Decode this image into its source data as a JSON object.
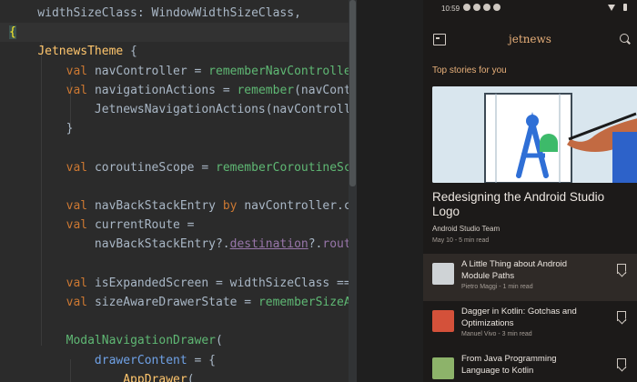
{
  "editor": {
    "lines": [
      [
        [
          "    widthSizeClass: WindowWidthSizeClass,",
          "plain"
        ]
      ],
      [
        [
          "{",
          "plain"
        ]
      ],
      [
        [
          "    ",
          "plain"
        ],
        [
          "JetnewsTheme",
          "fn"
        ],
        [
          " {",
          "plain"
        ]
      ],
      [
        [
          "        ",
          "plain"
        ],
        [
          "val ",
          "kw"
        ],
        [
          "navController = ",
          "plain"
        ],
        [
          "rememberNavController",
          "comp"
        ],
        [
          "()",
          "plain"
        ]
      ],
      [
        [
          "        ",
          "plain"
        ],
        [
          "val ",
          "kw"
        ],
        [
          "navigationActions = ",
          "plain"
        ],
        [
          "remember",
          "comp"
        ],
        [
          "(navContr",
          "plain"
        ]
      ],
      [
        [
          "            JetnewsNavigationActions(navControlle",
          "plain"
        ]
      ],
      [
        [
          "        }",
          "plain"
        ]
      ],
      [
        [
          "",
          "plain"
        ]
      ],
      [
        [
          "        ",
          "plain"
        ],
        [
          "val ",
          "kw"
        ],
        [
          "coroutineScope = ",
          "plain"
        ],
        [
          "rememberCoroutineSco",
          "comp"
        ]
      ],
      [
        [
          "",
          "plain"
        ]
      ],
      [
        [
          "        ",
          "plain"
        ],
        [
          "val ",
          "kw"
        ],
        [
          "navBackStackEntry ",
          "plain"
        ],
        [
          "by ",
          "kw"
        ],
        [
          "navController.",
          "plain"
        ],
        [
          "cu",
          "call"
        ]
      ],
      [
        [
          "        ",
          "plain"
        ],
        [
          "val ",
          "kw"
        ],
        [
          "currentRoute =",
          "plain"
        ]
      ],
      [
        [
          "            navBackStackEntry?.",
          "plain"
        ],
        [
          "destination",
          "prop-und"
        ],
        [
          "?.",
          "plain"
        ],
        [
          "route",
          "prop"
        ]
      ],
      [
        [
          "",
          "plain"
        ]
      ],
      [
        [
          "        ",
          "plain"
        ],
        [
          "val ",
          "kw"
        ],
        [
          "isExpandedScreen = widthSizeClass ==",
          "plain"
        ]
      ],
      [
        [
          "        ",
          "plain"
        ],
        [
          "val ",
          "kw"
        ],
        [
          "sizeAwareDrawerState = ",
          "plain"
        ],
        [
          "rememberSizeAw",
          "comp"
        ]
      ],
      [
        [
          "",
          "plain"
        ]
      ],
      [
        [
          "        ",
          "plain"
        ],
        [
          "ModalNavigationDrawer",
          "comp"
        ],
        [
          "(",
          "plain"
        ]
      ],
      [
        [
          "            ",
          "plain"
        ],
        [
          "drawerContent",
          "prop-blue"
        ],
        [
          " = {",
          "plain"
        ]
      ],
      [
        [
          "                ",
          "plain"
        ],
        [
          "AppDrawer",
          "fn"
        ],
        [
          "(",
          "plain"
        ]
      ]
    ]
  },
  "phone": {
    "status_time": "10:59",
    "app_title": "jetnews",
    "section_title": "Top stories for you",
    "hero": {
      "title": "Redesigning the Android Studio Logo",
      "author": "Android Studio Team",
      "meta": "May 10 - 5 min read"
    },
    "posts": [
      {
        "title": "A Little Thing about Android Module Paths",
        "meta": "Pietro Maggi - 1 min read",
        "thumb_color": "#cfd3d6",
        "selected": true
      },
      {
        "title": "Dagger in Kotlin: Gotchas and Optimizations",
        "meta": "Manuel Vivo - 3 min read",
        "thumb_color": "#d4513a",
        "selected": false
      },
      {
        "title": "From Java Programming Language to Kotlin",
        "meta": "",
        "thumb_color": "#8db36a",
        "selected": false
      }
    ],
    "colors": {
      "accent": "#e8b07a",
      "background": "#1c1a19"
    }
  }
}
